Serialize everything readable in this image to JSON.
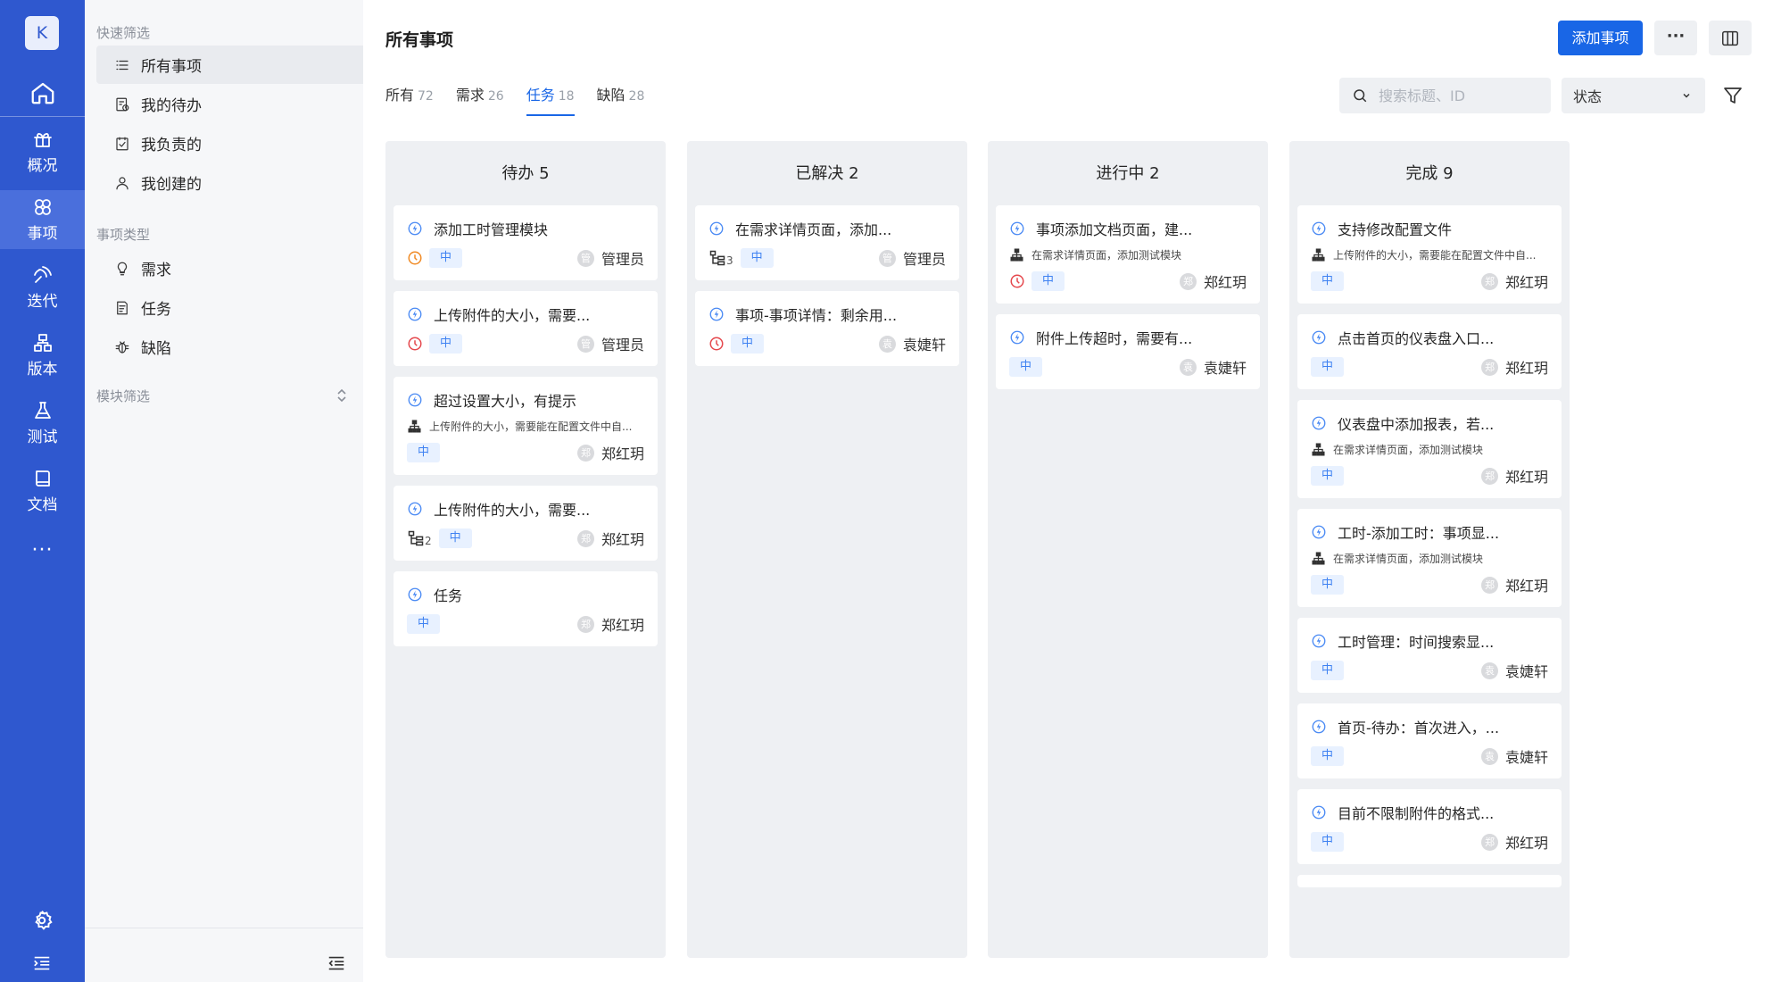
{
  "nav": {
    "avatar_letter": "K",
    "items": [
      {
        "label": "概况",
        "icon": "overview-icon"
      },
      {
        "label": "事项",
        "icon": "issues-icon"
      },
      {
        "label": "迭代",
        "icon": "iteration-icon"
      },
      {
        "label": "版本",
        "icon": "version-icon"
      },
      {
        "label": "测试",
        "icon": "test-icon"
      },
      {
        "label": "文档",
        "icon": "docs-icon"
      }
    ],
    "active": "事项",
    "more": "···"
  },
  "sidebar": {
    "quick_filter_title": "快速筛选",
    "quick_filters": [
      {
        "label": "所有事项",
        "icon": "list-icon"
      },
      {
        "label": "我的待办",
        "icon": "todo-icon"
      },
      {
        "label": "我负责的",
        "icon": "responsible-icon"
      },
      {
        "label": "我创建的",
        "icon": "user-icon"
      }
    ],
    "type_title": "事项类型",
    "types": [
      {
        "label": "需求",
        "icon": "lightbulb-icon"
      },
      {
        "label": "任务",
        "icon": "task-icon"
      },
      {
        "label": "缺陷",
        "icon": "bug-icon"
      }
    ],
    "module_title": "模块筛选"
  },
  "header": {
    "title": "所有事项",
    "add_button": "添加事项",
    "more_button": "···"
  },
  "tabs": [
    {
      "label": "所有",
      "count": "72"
    },
    {
      "label": "需求",
      "count": "26"
    },
    {
      "label": "任务",
      "count": "18"
    },
    {
      "label": "缺陷",
      "count": "28"
    }
  ],
  "active_tab": "任务",
  "search": {
    "placeholder": "搜索标题、ID",
    "value": ""
  },
  "status_select": {
    "value": "状态"
  },
  "colors": {
    "primary": "#1966e6",
    "nav": "#2f58cf",
    "priority_bg": "#e8f1ff",
    "priority_fg": "#3f82f2",
    "overdue": "#e5484d",
    "warning": "#f08a24"
  },
  "columns": [
    {
      "title": "待办 5",
      "cards": [
        {
          "title": "添加工时管理模块",
          "desc": "",
          "status_icon": "clock-orange-icon",
          "subtasks": "",
          "priority": "中",
          "assignee_initial": "管",
          "assignee": "管理员"
        },
        {
          "title": "上传附件的大小，需要...",
          "desc": "",
          "status_icon": "clock-red-icon",
          "subtasks": "",
          "priority": "中",
          "assignee_initial": "管",
          "assignee": "管理员"
        },
        {
          "title": "超过设置大小，有提示",
          "desc": "上传附件的大小，需要能在配置文件中自...",
          "status_icon": "",
          "subtasks": "",
          "priority": "中",
          "assignee_initial": "郑",
          "assignee": "郑红玥"
        },
        {
          "title": "上传附件的大小，需要...",
          "desc": "",
          "status_icon": "",
          "subtasks": "2",
          "priority": "中",
          "assignee_initial": "郑",
          "assignee": "郑红玥"
        },
        {
          "title": "任务",
          "desc": "",
          "status_icon": "",
          "subtasks": "",
          "priority": "中",
          "assignee_initial": "郑",
          "assignee": "郑红玥"
        }
      ]
    },
    {
      "title": "已解决 2",
      "cards": [
        {
          "title": "在需求详情页面，添加...",
          "desc": "",
          "status_icon": "",
          "subtasks": "3",
          "priority": "中",
          "assignee_initial": "管",
          "assignee": "管理员"
        },
        {
          "title": "事项-事项详情：剩余用...",
          "desc": "",
          "status_icon": "clock-red-icon",
          "subtasks": "",
          "priority": "中",
          "assignee_initial": "袁",
          "assignee": "袁婕轩"
        }
      ]
    },
    {
      "title": "进行中 2",
      "cards": [
        {
          "title": "事项添加文档页面，建...",
          "desc": "在需求详情页面，添加测试模块",
          "status_icon": "clock-red-icon",
          "subtasks": "",
          "priority": "中",
          "assignee_initial": "郑",
          "assignee": "郑红玥"
        },
        {
          "title": "附件上传超时，需要有...",
          "desc": "",
          "status_icon": "",
          "subtasks": "",
          "priority": "中",
          "assignee_initial": "袁",
          "assignee": "袁婕轩"
        }
      ]
    },
    {
      "title": "完成 9",
      "cards": [
        {
          "title": "支持修改配置文件",
          "desc": "上传附件的大小，需要能在配置文件中自...",
          "status_icon": "",
          "subtasks": "",
          "priority": "中",
          "assignee_initial": "郑",
          "assignee": "郑红玥"
        },
        {
          "title": "点击首页的仪表盘入口...",
          "desc": "",
          "status_icon": "",
          "subtasks": "",
          "priority": "中",
          "assignee_initial": "郑",
          "assignee": "郑红玥"
        },
        {
          "title": "仪表盘中添加报表，若...",
          "desc": "在需求详情页面，添加测试模块",
          "status_icon": "",
          "subtasks": "",
          "priority": "中",
          "assignee_initial": "郑",
          "assignee": "郑红玥"
        },
        {
          "title": "工时-添加工时：事项显...",
          "desc": "在需求详情页面，添加测试模块",
          "status_icon": "",
          "subtasks": "",
          "priority": "中",
          "assignee_initial": "郑",
          "assignee": "郑红玥"
        },
        {
          "title": "工时管理：时间搜索显...",
          "desc": "",
          "status_icon": "",
          "subtasks": "",
          "priority": "中",
          "assignee_initial": "袁",
          "assignee": "袁婕轩"
        },
        {
          "title": "首页-待办：首次进入，...",
          "desc": "",
          "status_icon": "",
          "subtasks": "",
          "priority": "中",
          "assignee_initial": "袁",
          "assignee": "袁婕轩"
        },
        {
          "title": "目前不限制附件的格式...",
          "desc": "",
          "status_icon": "",
          "subtasks": "",
          "priority": "中",
          "assignee_initial": "郑",
          "assignee": "郑红玥"
        }
      ]
    }
  ]
}
